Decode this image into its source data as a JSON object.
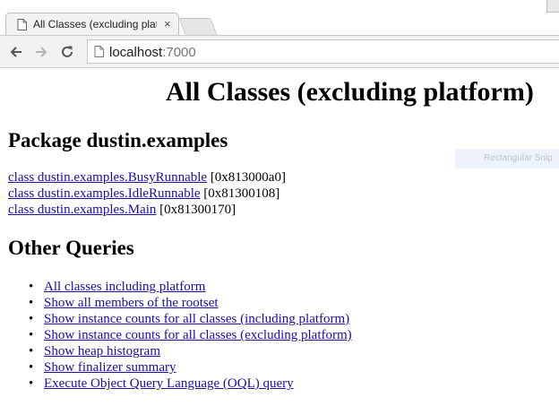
{
  "browser": {
    "tab": {
      "title": "All Classes (excluding platf",
      "close": "×"
    },
    "address_bar": {
      "host": "localhost",
      "port": ":7000"
    }
  },
  "page": {
    "title": "All Classes (excluding platform)",
    "package_heading": "Package dustin.examples",
    "classes": [
      {
        "link": "class dustin.examples.BusyRunnable",
        "address": " [0x813000a0]"
      },
      {
        "link": "class dustin.examples.IdleRunnable",
        "address": " [0x81300108]"
      },
      {
        "link": "class dustin.examples.Main",
        "address": " [0x81300170]"
      }
    ],
    "other_queries_heading": "Other Queries",
    "queries": [
      "All classes including platform",
      "Show all members of the rootset",
      "Show instance counts for all classes (including platform)",
      "Show instance counts for all classes (excluding platform)",
      "Show heap histogram",
      "Show finalizer summary",
      "Execute Object Query Language (OQL) query"
    ]
  },
  "overlay": {
    "ghost_text": "Rectangular Snip"
  },
  "colors": {
    "link": "#1a0dab",
    "chrome": "#f2f2f2"
  }
}
